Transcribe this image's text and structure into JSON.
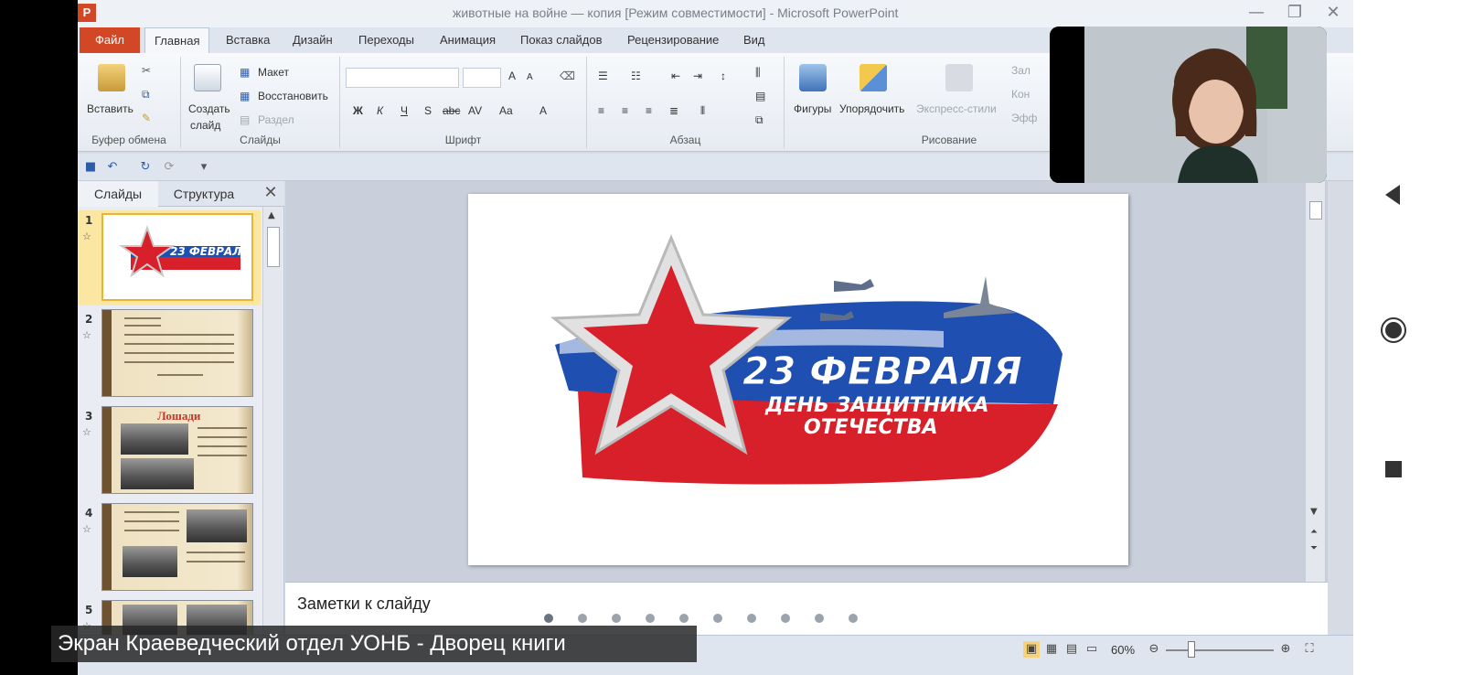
{
  "window": {
    "title": "животные на войне — копия [Режим совместимости] - Microsoft PowerPoint",
    "app_icon_letter": "P"
  },
  "tabs": [
    "Файл",
    "Главная",
    "Вставка",
    "Дизайн",
    "Переходы",
    "Анимация",
    "Показ слайдов",
    "Рецензирование",
    "Вид"
  ],
  "ribbon": {
    "clipboard": {
      "paste": "Вставить",
      "label": "Буфер обмена"
    },
    "slides": {
      "create": "Создать",
      "create2": "слайд",
      "layout": "Макет",
      "restore": "Восстановить",
      "section": "Раздел",
      "label": "Слайды"
    },
    "font": {
      "label": "Шрифт",
      "bold": "Ж",
      "italic": "К",
      "underline": "Ч",
      "strike": "S",
      "shadow": "abc",
      "case": "Aa",
      "color": "A",
      "grow": "A",
      "shrink": "A"
    },
    "paragraph": {
      "label": "Абзац"
    },
    "drawing": {
      "shapes": "Фигуры",
      "arrange": "Упорядочить",
      "quick_styles": "Экспресс-стили",
      "label": "Рисование",
      "fill": "Зал",
      "outline": "Кон",
      "effects": "Эфф"
    }
  },
  "slides_pane": {
    "tab_slides": "Слайды",
    "tab_outline": "Структура",
    "close": "✕",
    "thumbs": [
      {
        "num": "1",
        "title": "23 ФЕВРАЛЯ",
        "subtitle": "ДЕНЬ ЗАЩИТНИКА ОТЕЧЕСТВА"
      },
      {
        "num": "2"
      },
      {
        "num": "3",
        "title": "Лошади"
      },
      {
        "num": "4"
      },
      {
        "num": "5"
      }
    ]
  },
  "slide": {
    "line1": "23 ФЕВРАЛЯ",
    "line2": "ДЕНЬ ЗАЩИТНИКА",
    "line3": "ОТЕЧЕСТВА"
  },
  "notes": {
    "placeholder": "Заметки к слайду"
  },
  "status": {
    "zoom": "60%"
  },
  "caption": "Экран Краеведческий отдел УОНБ - Дворец книги",
  "colors": {
    "file_tab": "#d24726",
    "flag_red": "#d8202b",
    "flag_blue": "#1f4fb0"
  }
}
